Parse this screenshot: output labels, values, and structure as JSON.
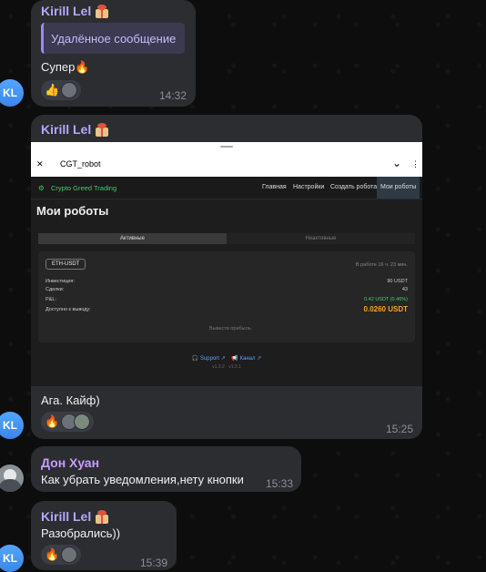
{
  "messages": [
    {
      "sender": "Kirill Lel",
      "reply_text": "Удалённое сообщение",
      "text": "Супер🔥",
      "reaction": "👍",
      "time": "14:32",
      "avatar": "KL"
    },
    {
      "sender": "Kirill Lel",
      "text": "Ага. Кайф)",
      "reaction": "🔥",
      "time": "15:25",
      "avatar": "KL"
    },
    {
      "sender": "Дон Хуан",
      "text": "Как убрать уведомления,нету кнопки",
      "time": "15:33"
    },
    {
      "sender": "Kirill Lel",
      "text": "Разобрались))",
      "reaction": "🔥",
      "time": "15:39",
      "avatar": "KL"
    }
  ],
  "shot": {
    "close": "✕",
    "title": "CGT_robot",
    "chevron": "⌄",
    "menu": "⋮",
    "brand": "Crypto Greed Trading",
    "nav": [
      "Главная",
      "Настройки",
      "Создать робота",
      "Мои роботы"
    ],
    "heading": "Мои роботы",
    "tab_active": "Активные",
    "tab_inactive": "Неактивные",
    "pair": "ETH-USDT",
    "uptime": "В работе 16 ч. 23 мин.",
    "rows": [
      {
        "label": "Инвестиция:",
        "value": "90 USDT"
      },
      {
        "label": "Сделки:",
        "value": "43"
      },
      {
        "label": "P&L:",
        "value": "0.42 USDT (0.46%)"
      },
      {
        "label": "Доступно к выводу:",
        "value": "0.0260 USDT"
      }
    ],
    "withdraw": "Вывести прибыль",
    "support": "🎧 Support ↗",
    "channel": "📢 Канал ↗",
    "version": "v1.3.2 · v1.0.1"
  }
}
